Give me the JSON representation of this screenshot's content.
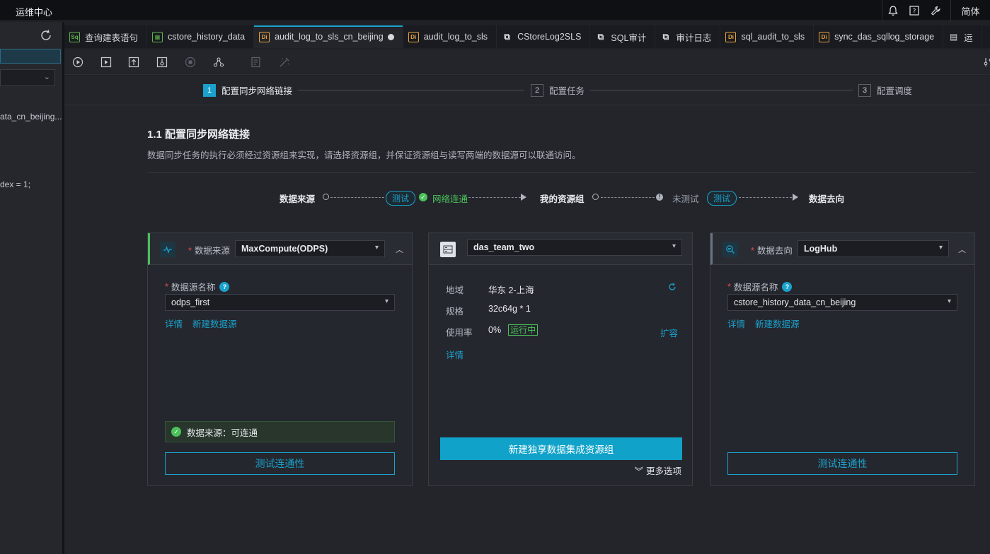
{
  "topbar": {
    "title": "运维中心",
    "lang": "简体"
  },
  "left": {
    "snippet1": "ata_cn_beijing...",
    "snippet2": "dex = 1;"
  },
  "tabs": [
    {
      "icon": "Sq",
      "label": "查询建表语句"
    },
    {
      "icon": "▦",
      "label": "cstore_history_data"
    },
    {
      "icon": "Di",
      "label": "audit_log_to_sls_cn_beijing"
    },
    {
      "icon": "Di",
      "label": "audit_log_to_sls"
    },
    {
      "icon": "⧉",
      "label": "CStoreLog2SLS"
    },
    {
      "icon": "⧉",
      "label": "SQL审计"
    },
    {
      "icon": "⧉",
      "label": "审计日志"
    },
    {
      "icon": "Di",
      "label": "sql_audit_to_sls"
    },
    {
      "icon": "Di",
      "label": "sync_das_sqllog_storage"
    },
    {
      "icon": "▤",
      "label": "运"
    }
  ],
  "steps": [
    {
      "num": "1",
      "label": "配置同步网络链接"
    },
    {
      "num": "2",
      "label": "配置任务"
    },
    {
      "num": "3",
      "label": "配置调度"
    }
  ],
  "section": {
    "title": "1.1 配置同步网络链接",
    "desc": "数据同步任务的执行必须经过资源组来实现，请选择资源组，并保证资源组与读写两端的数据源可以联通访问。"
  },
  "flow": {
    "source": "数据来源",
    "test1": "测试",
    "connected": "网络连通",
    "group": "我的资源组",
    "untested": "未测试",
    "test2": "测试",
    "dest": "数据去向"
  },
  "source_card": {
    "head_label": "数据来源",
    "type": "MaxCompute(ODPS)",
    "name_label": "数据源名称",
    "name_value": "odps_first",
    "link_detail": "详情",
    "link_new": "新建数据源",
    "status": "数据来源：可连通",
    "test_btn": "测试连通性"
  },
  "group_card": {
    "name": "das_team_two",
    "region_key": "地域",
    "region_val": "华东 2-上海",
    "spec_key": "规格",
    "spec_val": "32c64g * 1",
    "usage_key": "使用率",
    "usage_val": "0%",
    "running": "运行中",
    "expand": "扩容",
    "detail": "详情",
    "create_btn": "新建独享数据集成资源组",
    "more": "更多选项"
  },
  "dest_card": {
    "head_label": "数据去向",
    "type": "LogHub",
    "name_label": "数据源名称",
    "name_value": "cstore_history_data_cn_beijing",
    "link_detail": "详情",
    "link_new": "新建数据源",
    "test_btn": "测试连通性"
  }
}
